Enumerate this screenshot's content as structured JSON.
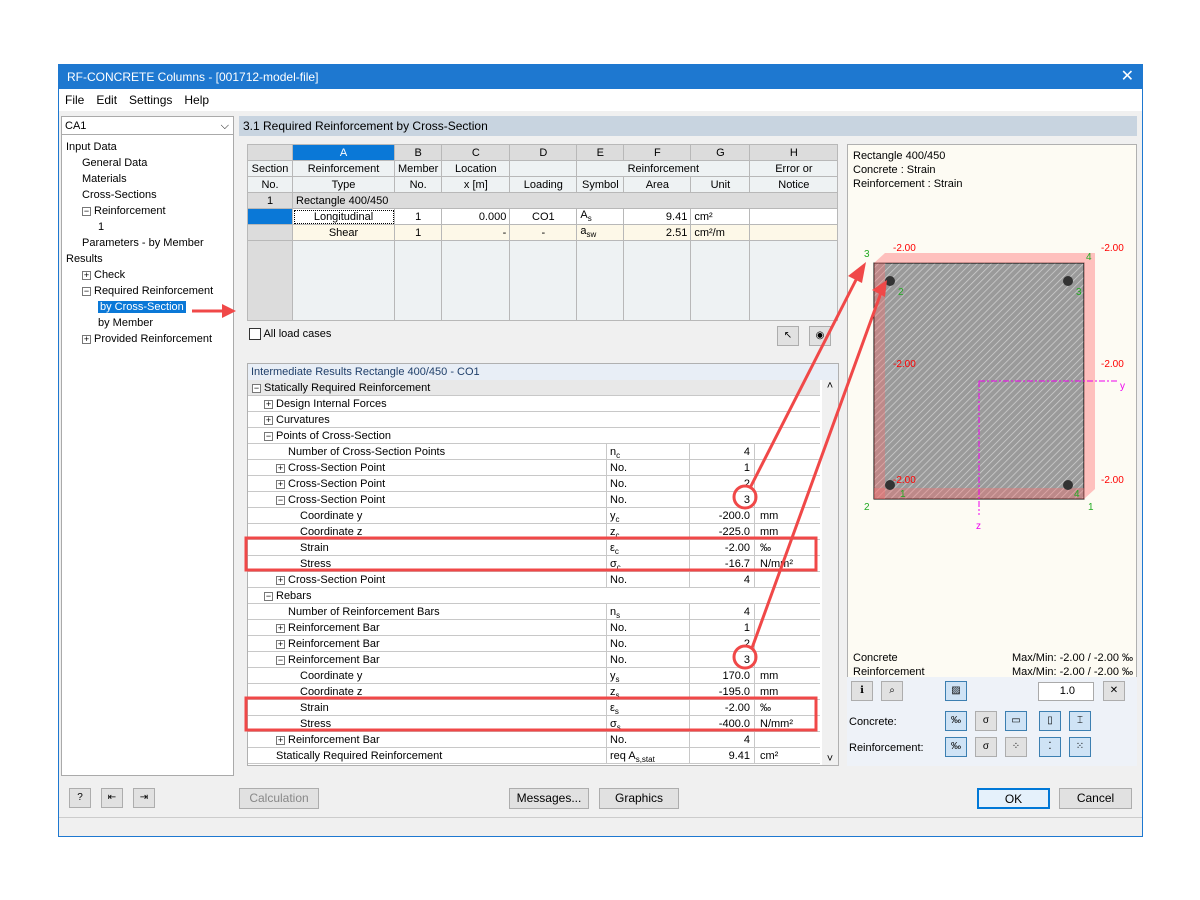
{
  "window": {
    "title": "RF-CONCRETE Columns - [001712-model-file]",
    "close": "✕"
  },
  "menu": [
    "File",
    "Edit",
    "Settings",
    "Help"
  ],
  "left": {
    "combo": "CA1",
    "tree": [
      {
        "label": "Input Data",
        "indent": 0
      },
      {
        "label": "General Data",
        "indent": 1
      },
      {
        "label": "Materials",
        "indent": 1
      },
      {
        "label": "Cross-Sections",
        "indent": 1
      },
      {
        "label": "Reinforcement",
        "indent": 1,
        "exp": "−"
      },
      {
        "label": "1",
        "indent": 2
      },
      {
        "label": "Parameters - by Member",
        "indent": 1
      },
      {
        "label": "Results",
        "indent": 0
      },
      {
        "label": "Check",
        "indent": 1,
        "exp": "+"
      },
      {
        "label": "Required Reinforcement",
        "indent": 1,
        "exp": "−"
      },
      {
        "label": "by Cross-Section",
        "indent": 2,
        "selected": true
      },
      {
        "label": "by Member",
        "indent": 2
      },
      {
        "label": "Provided Reinforcement",
        "indent": 1,
        "exp": "+"
      }
    ]
  },
  "main": {
    "title": "3.1 Required Reinforcement by Cross-Section"
  },
  "table": {
    "letters": [
      "A",
      "B",
      "C",
      "D",
      "E",
      "F",
      "G",
      "H"
    ],
    "h1": [
      "Section",
      "Reinforcement",
      "Member",
      "Location",
      "",
      "Reinforcement",
      "Error or"
    ],
    "h2": [
      "No.",
      "Type",
      "No.",
      "x [m]",
      "Loading",
      "Symbol",
      "Area",
      "Unit",
      "Notice"
    ],
    "group": {
      "no": "1",
      "label": "Rectangle 400/450"
    },
    "rows": [
      {
        "type": "Longitudinal",
        "member": "1",
        "x": "0.000",
        "loading": "CO1",
        "sym": "A",
        "sub": "s",
        "area": "9.41",
        "unit": "cm²"
      },
      {
        "type": "Shear",
        "member": "1",
        "x": "-",
        "loading": "-",
        "sym": "a",
        "sub": "sw",
        "area": "2.51",
        "unit": "cm²/m"
      }
    ],
    "all_load_cases": "All load cases"
  },
  "ir": {
    "title": "Intermediate Results Rectangle 400/450 - CO1",
    "rows": [
      {
        "l": "Statically Required Reinforcement",
        "i": 0,
        "e": "−"
      },
      {
        "l": "Design Internal Forces",
        "i": 1,
        "e": "+"
      },
      {
        "l": "Curvatures",
        "i": 1,
        "e": "+"
      },
      {
        "l": "Points of Cross-Section",
        "i": 1,
        "e": "−"
      },
      {
        "l": "Number of Cross-Section Points",
        "i": 2,
        "s": "n",
        "sb": "c",
        "v": "4"
      },
      {
        "l": "Cross-Section Point",
        "i": 2,
        "e": "+",
        "s": "No.",
        "v": "1"
      },
      {
        "l": "Cross-Section Point",
        "i": 2,
        "e": "+",
        "s": "No.",
        "v": "2"
      },
      {
        "l": "Cross-Section Point",
        "i": 2,
        "e": "−",
        "s": "No.",
        "v": "3"
      },
      {
        "l": "Coordinate y",
        "i": 3,
        "s": "y",
        "sb": "c",
        "v": "-200.0",
        "u": "mm"
      },
      {
        "l": "Coordinate z",
        "i": 3,
        "s": "z",
        "sb": "c",
        "v": "-225.0",
        "u": "mm"
      },
      {
        "l": "Strain",
        "i": 3,
        "s": "ε",
        "sb": "c",
        "v": "-2.00",
        "u": "‰"
      },
      {
        "l": "Stress",
        "i": 3,
        "s": "σ",
        "sb": "c",
        "v": "-16.7",
        "u": "N/mm²"
      },
      {
        "l": "Cross-Section Point",
        "i": 2,
        "e": "+",
        "s": "No.",
        "v": "4"
      },
      {
        "l": "Rebars",
        "i": 1,
        "e": "−"
      },
      {
        "l": "Number of Reinforcement Bars",
        "i": 2,
        "s": "n",
        "sb": "s",
        "v": "4"
      },
      {
        "l": "Reinforcement Bar",
        "i": 2,
        "e": "+",
        "s": "No.",
        "v": "1"
      },
      {
        "l": "Reinforcement Bar",
        "i": 2,
        "e": "+",
        "s": "No.",
        "v": "2"
      },
      {
        "l": "Reinforcement Bar",
        "i": 2,
        "e": "−",
        "s": "No.",
        "v": "3"
      },
      {
        "l": "Coordinate y",
        "i": 3,
        "s": "y",
        "sb": "s",
        "v": "170.0",
        "u": "mm"
      },
      {
        "l": "Coordinate z",
        "i": 3,
        "s": "z",
        "sb": "s",
        "v": "-195.0",
        "u": "mm"
      },
      {
        "l": "Strain",
        "i": 3,
        "s": "ε",
        "sb": "s",
        "v": "-2.00",
        "u": "‰"
      },
      {
        "l": "Stress",
        "i": 3,
        "s": "σ",
        "sb": "s",
        "v": "-400.0",
        "u": "N/mm²"
      },
      {
        "l": "Reinforcement Bar",
        "i": 2,
        "e": "+",
        "s": "No.",
        "v": "4"
      },
      {
        "l": "Statically Required Reinforcement",
        "i": 1,
        "s": "req A",
        "sb": "s,stat",
        "v": "9.41",
        "u": "cm²"
      }
    ]
  },
  "graphic": {
    "info": [
      "Rectangle 400/450",
      "Concrete : Strain",
      "Reinforcement : Strain"
    ],
    "strain_label": "-2.00",
    "corner_points": [
      "1",
      "2",
      "3",
      "4"
    ],
    "bar_points": [
      "1",
      "2",
      "3",
      "4"
    ],
    "axis_y": "y",
    "axis_z": "z",
    "concrete": "Concrete",
    "concrete_maxmin": "Max/Min: -2.00 / -2.00 ‰",
    "reinforcement": "Reinforcement",
    "reinforcement_maxmin": "Max/Min: -2.00 / -2.00 ‰",
    "scale": "1.0",
    "concrete_label": "Concrete:",
    "reinforcement_label": "Reinforcement:"
  },
  "buttons": {
    "calculation": "Calculation",
    "messages": "Messages...",
    "graphics": "Graphics",
    "ok": "OK",
    "cancel": "Cancel"
  },
  "colors": {
    "title": "#1e78d0",
    "selected": "#0a78d7",
    "annotation": "#f04848",
    "strain": "#ff9a9a"
  }
}
